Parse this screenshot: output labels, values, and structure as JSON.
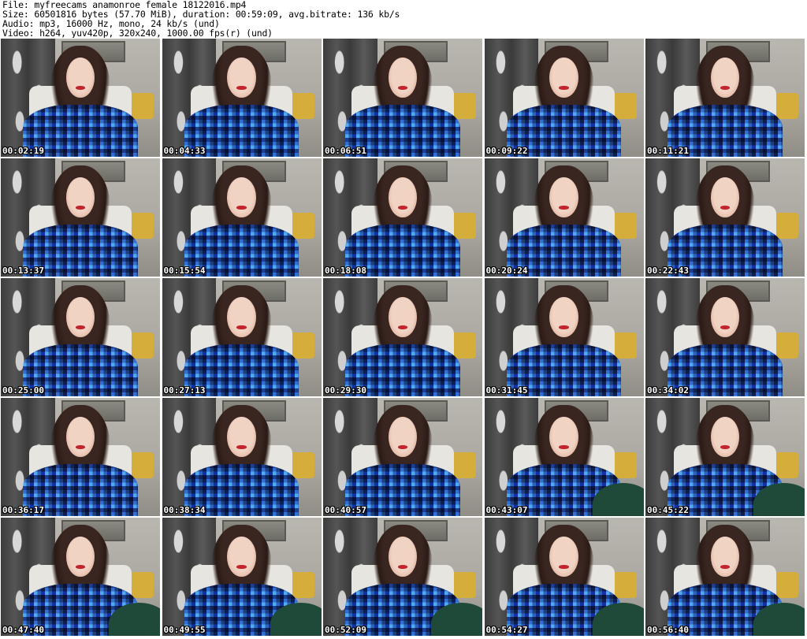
{
  "header": {
    "file_line": "File: myfreecams_anamonroe_female_18122016.mp4",
    "size_line": "Size: 60501816 bytes (57.70 MiB), duration: 00:59:09, avg.bitrate: 136 kb/s",
    "audio_line": "Audio: mp3, 16000 Hz, mono, 24 kb/s (und)",
    "video_line": "Video: h264, yuv420p, 320x240, 1000.00 fps(r) (und)"
  },
  "thumbnails": [
    {
      "timestamp": "00:02:19"
    },
    {
      "timestamp": "00:04:33"
    },
    {
      "timestamp": "00:06:51"
    },
    {
      "timestamp": "00:09:22"
    },
    {
      "timestamp": "00:11:21"
    },
    {
      "timestamp": "00:13:37"
    },
    {
      "timestamp": "00:15:54"
    },
    {
      "timestamp": "00:18:08"
    },
    {
      "timestamp": "00:20:24"
    },
    {
      "timestamp": "00:22:43"
    },
    {
      "timestamp": "00:25:00"
    },
    {
      "timestamp": "00:27:13"
    },
    {
      "timestamp": "00:29:30"
    },
    {
      "timestamp": "00:31:45"
    },
    {
      "timestamp": "00:34:02"
    },
    {
      "timestamp": "00:36:17"
    },
    {
      "timestamp": "00:38:34"
    },
    {
      "timestamp": "00:40:57"
    },
    {
      "timestamp": "00:43:07"
    },
    {
      "timestamp": "00:45:22"
    },
    {
      "timestamp": "00:47:40"
    },
    {
      "timestamp": "00:49:55"
    },
    {
      "timestamp": "00:52:09"
    },
    {
      "timestamp": "00:54:27"
    },
    {
      "timestamp": "00:56:40"
    }
  ],
  "colors": {
    "background": "#ffffff",
    "header_text": "#000000",
    "timestamp_text": "#ffffff",
    "timestamp_outline": "#000000"
  }
}
